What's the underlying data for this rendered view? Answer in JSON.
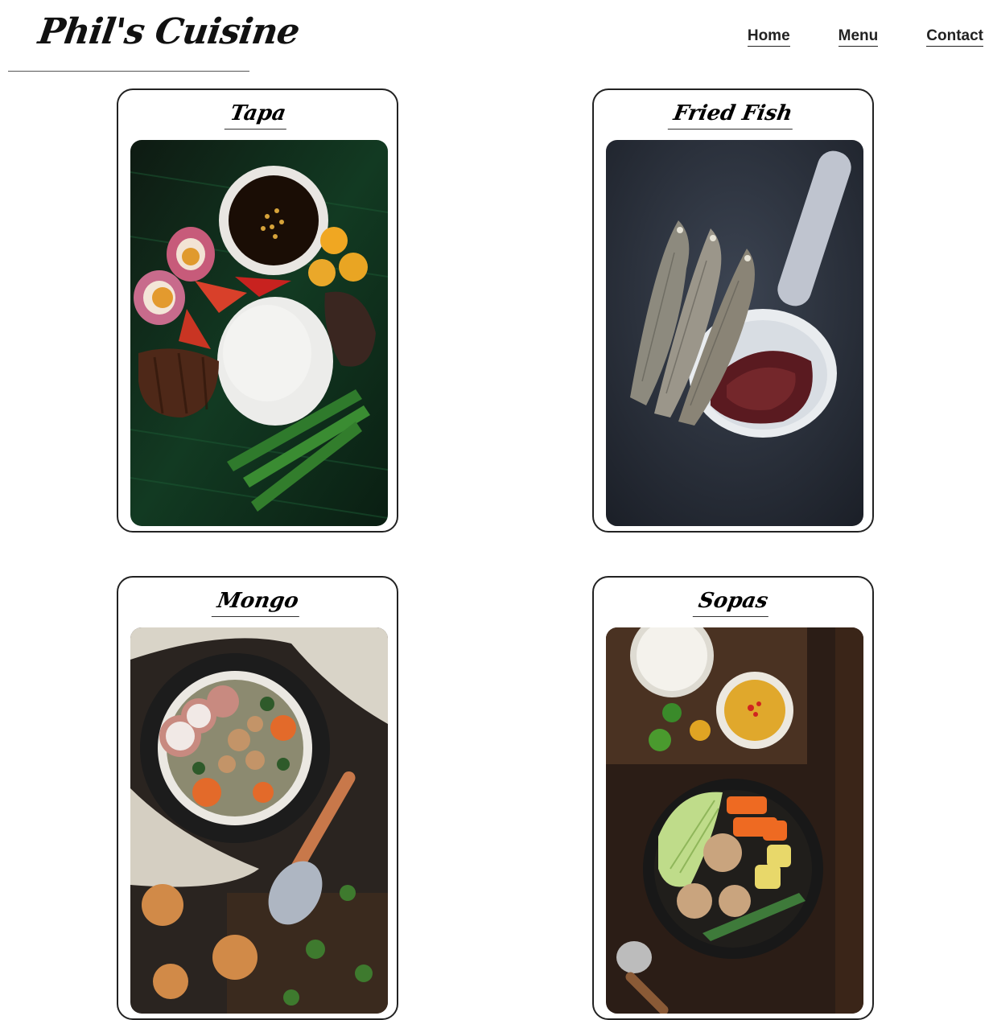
{
  "site": {
    "logo": "Phil's Cuisine"
  },
  "nav": {
    "items": [
      {
        "label": "Home"
      },
      {
        "label": "Menu"
      },
      {
        "label": "Contact"
      }
    ]
  },
  "menu": {
    "dishes": [
      {
        "name": "Tapa",
        "photo": "tapa-photo"
      },
      {
        "name": "Fried Fish",
        "photo": "fried-fish-photo"
      },
      {
        "name": "Mongo",
        "photo": "mongo-photo"
      },
      {
        "name": "Sopas",
        "photo": "sopas-photo"
      }
    ]
  }
}
